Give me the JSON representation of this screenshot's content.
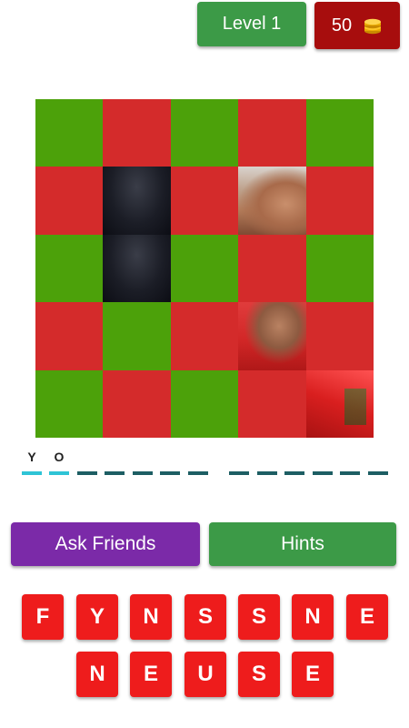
{
  "header": {
    "level_label": "Level 1",
    "coins": "50",
    "coin_icon": "coins-stack-icon"
  },
  "board": {
    "tiles": [
      "green",
      "red",
      "green",
      "red",
      "green",
      "red",
      "photo",
      "red",
      "photo",
      "red",
      "green",
      "photo",
      "green",
      "red",
      "green",
      "red",
      "green",
      "red",
      "photo",
      "red",
      "green",
      "red",
      "green",
      "red",
      "photo"
    ]
  },
  "answer": {
    "slots": [
      "Y",
      "O",
      "",
      "",
      "",
      "",
      "",
      "",
      "",
      "",
      "",
      "",
      "",
      "",
      ""
    ]
  },
  "actions": {
    "ask_friends_label": "Ask Friends",
    "hints_label": "Hints"
  },
  "keyboard": {
    "row1": [
      "F",
      "Y",
      "N",
      "S",
      "S",
      "N",
      "E"
    ],
    "row2": [
      "N",
      "E",
      "U",
      "S",
      "E"
    ]
  },
  "colors": {
    "tile_green": "#4ca10a",
    "tile_red": "#d42b2b",
    "level_button": "#3c9a47",
    "coins_box": "#a70d0d",
    "ask_button": "#7b2aa8",
    "hints_button": "#3c9a47",
    "letter_key": "#ee1c1c",
    "slot_filled": "#2ec4d6",
    "slot_empty": "#1d5e63"
  }
}
